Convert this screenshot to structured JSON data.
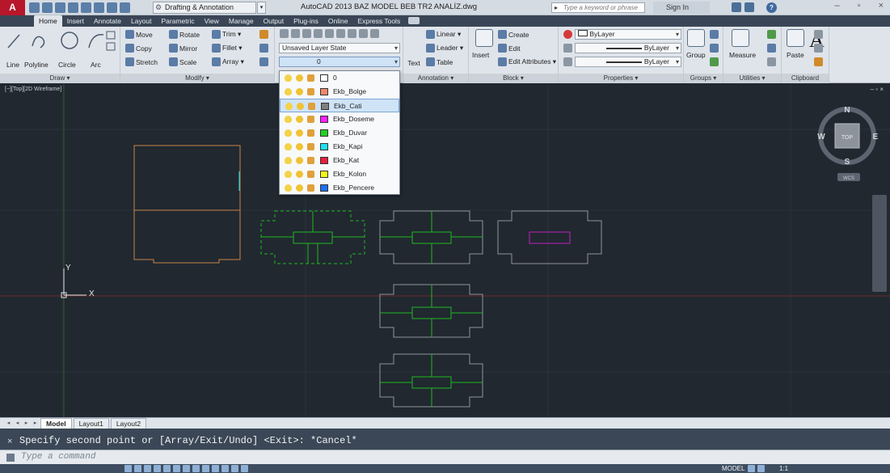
{
  "app": {
    "logo_text": "A",
    "workspace": "Drafting & Annotation",
    "title": "AutoCAD 2013   BAZ MODEL BEB TR2 ANALİZ.dwg",
    "search_placeholder": "Type a keyword or phrase",
    "signin_label": "Sign In"
  },
  "tabs": [
    "Home",
    "Insert",
    "Annotate",
    "Layout",
    "Parametric",
    "View",
    "Manage",
    "Output",
    "Plug-ins",
    "Online",
    "Express Tools"
  ],
  "ribbon": {
    "draw": {
      "title": "Draw ▾",
      "line": "Line",
      "polyline": "Polyline",
      "circle": "Circle",
      "arc": "Arc"
    },
    "modify": {
      "title": "Modify ▾",
      "move": "Move",
      "rotate": "Rotate",
      "trim": "Trim ▾",
      "copy": "Copy",
      "mirror": "Mirror",
      "fillet": "Fillet ▾",
      "stretch": "Stretch",
      "scale": "Scale",
      "array": "Array ▾"
    },
    "layers": {
      "layer_state": "Unsaved Layer State",
      "current_layer": "0"
    },
    "annotation": {
      "title": "Annotation ▾",
      "text": "Text",
      "linear": "Linear ▾",
      "leader": "Leader ▾",
      "table": "Table"
    },
    "block": {
      "title": "Block ▾",
      "insert": "Insert",
      "create": "Create",
      "edit": "Edit",
      "edit_attributes": "Edit Attributes ▾"
    },
    "properties": {
      "title": "Properties ▾",
      "color": "ByLayer",
      "lineweight": "ByLayer",
      "linetype": "ByLayer"
    },
    "groups": {
      "title": "Groups ▾",
      "group": "Group"
    },
    "utilities": {
      "title": "Utilities ▾",
      "measure": "Measure"
    },
    "clipboard": {
      "title": "Clipboard",
      "paste": "Paste"
    }
  },
  "layer_dropdown": [
    {
      "name": "0",
      "color": "#ffffff",
      "selected": false
    },
    {
      "name": "Ekb_Bolge",
      "color": "#f08a6a",
      "selected": false
    },
    {
      "name": "Ekb_Cati",
      "color": "#808080",
      "selected": true
    },
    {
      "name": "Ekb_Doseme",
      "color": "#ff1fff",
      "selected": false
    },
    {
      "name": "Ekb_Duvar",
      "color": "#22d022",
      "selected": false
    },
    {
      "name": "Ekb_Kapi",
      "color": "#20e0f0",
      "selected": false
    },
    {
      "name": "Ekb_Kat",
      "color": "#e8203c",
      "selected": false
    },
    {
      "name": "Ekb_Kolon",
      "color": "#f5f51a",
      "selected": false
    },
    {
      "name": "Ekb_Pencere",
      "color": "#1f6ef0",
      "selected": false
    }
  ],
  "viewport": {
    "label": "[−][Top][2D Wireframe]",
    "controls": "– ▫ ×",
    "viewcube": {
      "n": "N",
      "s": "S",
      "e": "E",
      "w": "W",
      "face": "TOP",
      "wcs": "WCS"
    },
    "ucs": {
      "x": "X",
      "y": "Y"
    }
  },
  "layout_tabs": [
    "Model",
    "Layout1",
    "Layout2"
  ],
  "command": {
    "history": "Specify second point or [Array/Exit/Undo] <Exit>: *Cancel*",
    "prompt": "Type a command"
  },
  "status": {
    "model": "MODEL",
    "scale": "1:1"
  },
  "colors": {
    "background": "#212830",
    "orange": "#c8844a",
    "green": "#1fb81f",
    "gray": "#8e939a",
    "magenta": "#c020c0"
  }
}
